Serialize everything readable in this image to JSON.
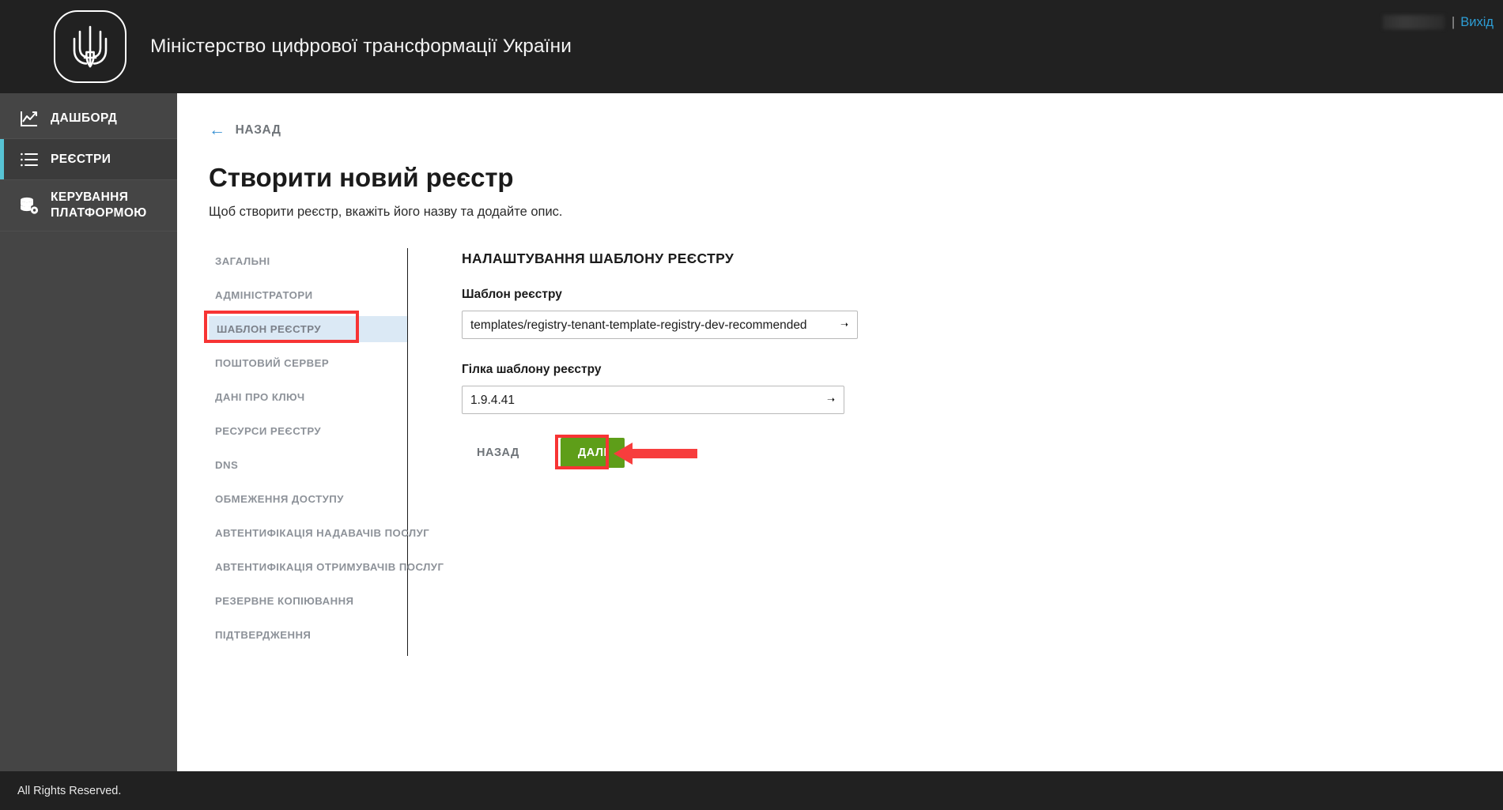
{
  "header": {
    "brand_title": "Міністерство цифрової трансформації України",
    "logo_icon": "ukraine-trident-icon",
    "user_redacted": "",
    "separator": "|",
    "logout_label": "Вихід"
  },
  "sidebar": {
    "items": [
      {
        "label": "ДАШБОРД",
        "icon": "chart-icon",
        "active": false
      },
      {
        "label": "РЕЄСТРИ",
        "icon": "list-icon",
        "active": true
      },
      {
        "label": "КЕРУВАННЯ ПЛАТФОРМОЮ",
        "icon": "database-gear-icon",
        "active": false
      }
    ],
    "active_accent_color": "#57c3d4"
  },
  "main": {
    "back_link_label": "НАЗАД",
    "back_arrow_icon": "arrow-left-icon",
    "page_title": "Створити новий реєстр",
    "page_subtitle": "Щоб створити реєстр, вкажіть його назву та додайте опис.",
    "steps": [
      {
        "label": "ЗАГАЛЬНІ",
        "current": false
      },
      {
        "label": "АДМІНІСТРАТОРИ",
        "current": false
      },
      {
        "label": "ШАБЛОН РЕЄСТРУ",
        "current": true
      },
      {
        "label": "ПОШТОВИЙ СЕРВЕР",
        "current": false
      },
      {
        "label": "ДАНІ ПРО КЛЮЧ",
        "current": false
      },
      {
        "label": "РЕСУРСИ РЕЄСТРУ",
        "current": false
      },
      {
        "label": "DNS",
        "current": false
      },
      {
        "label": "ОБМЕЖЕННЯ ДОСТУПУ",
        "current": false
      },
      {
        "label": "АВТЕНТИФІКАЦІЯ НАДАВАЧІВ ПОСЛУГ",
        "current": false
      },
      {
        "label": "АВТЕНТИФІКАЦІЯ ОТРИМУВАЧІВ ПОСЛУГ",
        "current": false
      },
      {
        "label": "РЕЗЕРВНЕ КОПІЮВАННЯ",
        "current": false
      },
      {
        "label": "ПІДТВЕРДЖЕННЯ",
        "current": false
      }
    ],
    "form": {
      "section_heading": "НАЛАШТУВАННЯ ШАБЛОНУ РЕЄСТРУ",
      "template_label": "Шаблон реєстру",
      "template_value": "templates/registry-tenant-template-registry-dev-recommended",
      "branch_label": "Гілка шаблону реєстру",
      "branch_value": "1.9.4.41",
      "chevron_icon": "chevron-down-icon"
    },
    "buttons": {
      "back_label": "НАЗАД",
      "next_label": "ДАЛІ",
      "next_color": "#5e9e19"
    },
    "annotations": {
      "highlight_color": "#f73434",
      "arrow_icon": "arrow-left-annotation"
    }
  },
  "footer": {
    "text": "All Rights Reserved."
  }
}
